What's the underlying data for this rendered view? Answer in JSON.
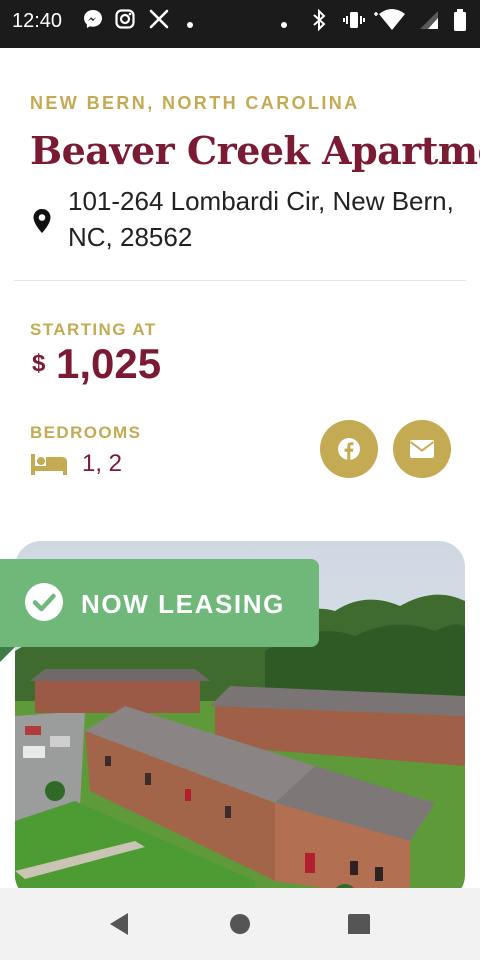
{
  "status_bar": {
    "time": "12:40",
    "left_icons": [
      "messenger-icon",
      "instagram-icon",
      "x-icon",
      "dot-icon"
    ],
    "right_icons": [
      "dot-icon",
      "bluetooth-icon",
      "vibrate-icon",
      "wifi-icon",
      "signal-icon",
      "battery-icon"
    ]
  },
  "property": {
    "location": "NEW BERN, NORTH CAROLINA",
    "name": "Beaver Creek Apartments",
    "address": "101-264 Lombardi Cir, New Bern, NC, 28562",
    "starting_label": "STARTING AT",
    "price_symbol": "$",
    "price_value": "1,025",
    "bedrooms_label": "BEDROOMS",
    "bedrooms_value": "1, 2"
  },
  "share": {
    "buttons": [
      {
        "name": "facebook",
        "icon": "facebook-icon"
      },
      {
        "name": "email",
        "icon": "envelope-icon"
      }
    ]
  },
  "banner": {
    "text": "NOW LEASING",
    "icon": "check-circle-icon"
  },
  "nav_bar": {
    "buttons": [
      "back-icon",
      "home-icon",
      "recents-icon"
    ]
  },
  "colors": {
    "maroon": "#7a1a33",
    "gold": "#c4aa52",
    "banner_green": "#6fb87a",
    "status_bar": "#1b1b1b"
  }
}
